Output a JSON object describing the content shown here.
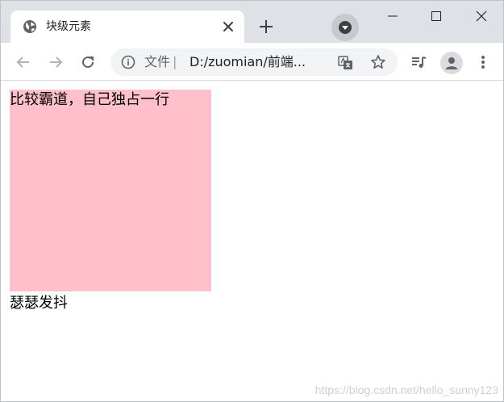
{
  "tab": {
    "title": "块级元素",
    "favicon": "globe-icon"
  },
  "omnibox": {
    "scheme_label": "文件",
    "separator": "|",
    "url": "D:/zuomian/前端..."
  },
  "page": {
    "block_text": "比较霸道，自己独占一行",
    "block_color": "#ffc0cb",
    "after_text": "瑟瑟发抖",
    "watermark": "https://blog.csdn.net/hello_sunny123"
  },
  "colors": {
    "tabstrip_bg": "#dee1e6",
    "icon": "#5f6368",
    "omnibox_bg": "#f1f3f4"
  }
}
